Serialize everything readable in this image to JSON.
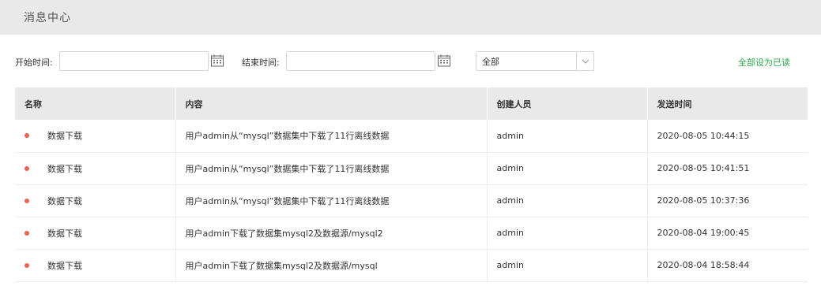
{
  "header": {
    "title": "消息中心"
  },
  "filters": {
    "start_label": "开始时间:",
    "start_value": "",
    "end_label": "结束时间:",
    "end_value": "",
    "status_select": "全部",
    "mark_all_read": "全部设为已读"
  },
  "table": {
    "columns": [
      "名称",
      "内容",
      "创建人员",
      "发送时间"
    ],
    "rows": [
      {
        "name": "数据下载",
        "content": "用户admin从“mysql”数据集中下载了11行离线数据",
        "creator": "admin",
        "time": "2020-08-05 10:44:15"
      },
      {
        "name": "数据下载",
        "content": "用户admin从“mysql”数据集中下载了11行离线数据",
        "creator": "admin",
        "time": "2020-08-05 10:41:51"
      },
      {
        "name": "数据下载",
        "content": "用户admin从“mysql”数据集中下载了11行离线数据",
        "creator": "admin",
        "time": "2020-08-05 10:37:36"
      },
      {
        "name": "数据下载",
        "content": "用户admin下载了数据集mysql2及数据源/mysql2",
        "creator": "admin",
        "time": "2020-08-04 19:00:45"
      },
      {
        "name": "数据下载",
        "content": "用户admin下载了数据集mysql2及数据源/mysql",
        "creator": "admin",
        "time": "2020-08-04 18:58:44"
      }
    ]
  },
  "colors": {
    "unread_dot": "#e8664f",
    "accent_green": "#2ba94b",
    "header_bg": "#e9e9e9"
  },
  "icons": {
    "date_picker": "calendar-icon",
    "select": "chevron-down-icon",
    "unread": "unread-dot-icon"
  }
}
